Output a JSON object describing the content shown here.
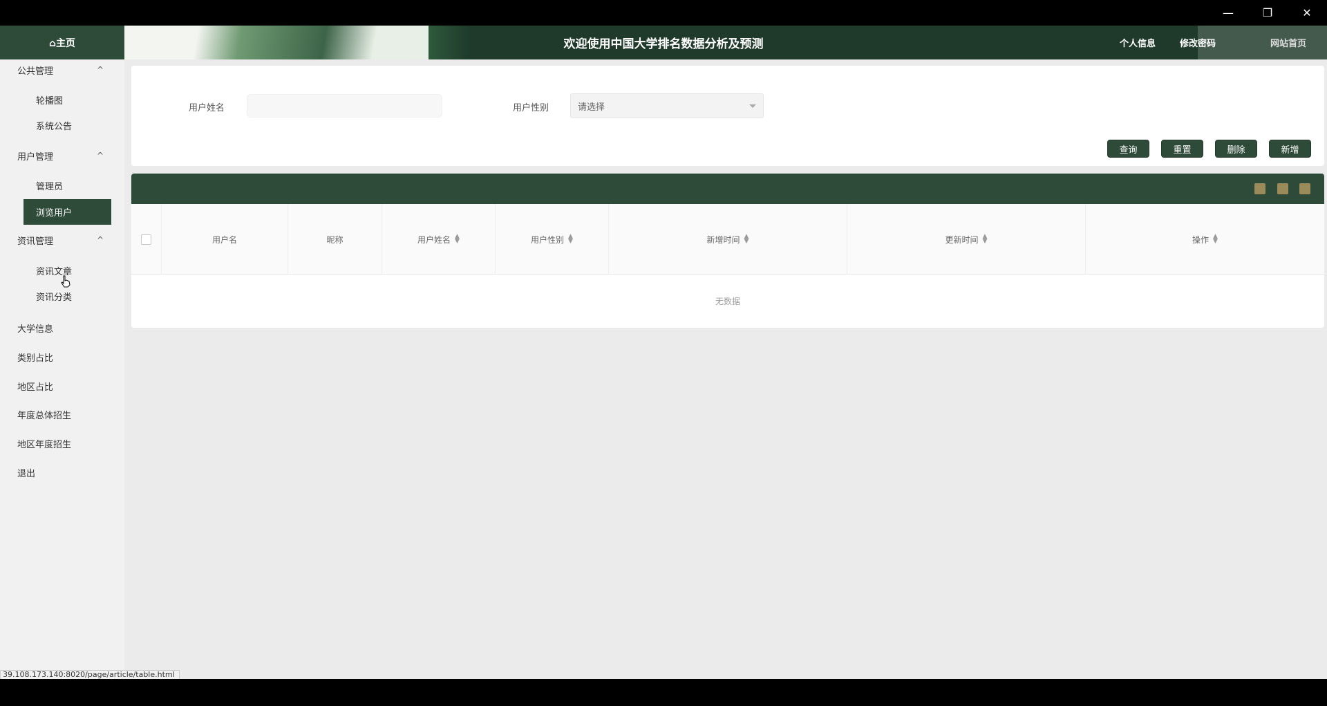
{
  "window_controls": {
    "minimize": "—",
    "maximize": "❐",
    "close": "✕"
  },
  "header": {
    "home": "⌂主页",
    "title": "欢迎使用中国大学排名数据分析及预测",
    "profile": "个人信息",
    "password": "修改密码",
    "site_home": "网站首页"
  },
  "sidebar": {
    "groups": [
      {
        "label": "公共管理",
        "chevron": "^",
        "items": [
          "轮播图",
          "系统公告"
        ]
      },
      {
        "label": "用户管理",
        "chevron": "^",
        "items": [
          "管理员",
          "浏览用户"
        ]
      },
      {
        "label": "资讯管理",
        "chevron": "^",
        "items": [
          "资讯文章",
          "资讯分类"
        ]
      }
    ],
    "links": [
      "大学信息",
      "类别占比",
      "地区占比",
      "年度总体招生",
      "地区年度招生",
      "退出"
    ],
    "active": "浏览用户"
  },
  "search": {
    "name_label": "用户姓名",
    "name_value": "",
    "gender_label": "用户性别",
    "gender_placeholder": "请选择"
  },
  "buttons": {
    "query": "查询",
    "reset": "重置",
    "delete": "删除",
    "add": "新增"
  },
  "table": {
    "columns": [
      "用户名",
      "昵称",
      "用户姓名",
      "用户性别",
      "新增时间",
      "更新时间",
      "操作"
    ],
    "sort_glyph": "▲\n▼",
    "empty_text": "无数据",
    "colors": {
      "toolbar": "#2e4a38",
      "tool_icon": "#9b8a5a"
    }
  },
  "status_url": "39.108.173.140:8020/page/article/table.html"
}
